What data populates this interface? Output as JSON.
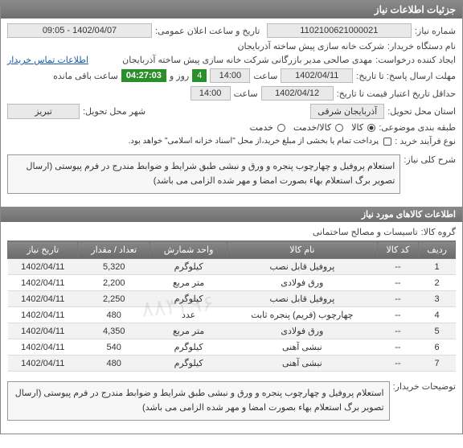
{
  "header": {
    "title": "جزئیات اطلاعات نیاز"
  },
  "info": {
    "req_no_label": "شماره نیاز:",
    "req_no": "1102100621000021",
    "datetime_label": "تاریخ و ساعت اعلان عمومی:",
    "datetime": "1402/04/07 - 09:05",
    "org_label": "نام دستگاه خریدار:",
    "org": "شرکت خانه سازی پیش ساخته آذربایجان",
    "creator_label": "ایجاد کننده درخواست:",
    "creator": "مهدی صالحی مدیر بازرگانی شرکت خانه سازی پیش ساخته آذربایجان",
    "contact_link": "اطلاعات تماس خریدار",
    "deadline_label": "مهلت ارسال پاسخ: تا تاریخ:",
    "deadline_date": "1402/04/11",
    "deadline_time_label": "ساعت",
    "deadline_time": "14:00",
    "remain_days": "4",
    "remain_days_label": "روز و",
    "countdown": "04:27:03",
    "remain_suffix": "ساعت باقی مانده",
    "valid_label": "حداقل تاریخ اعتبار قیمت تا تاریخ:",
    "valid_date": "1402/04/12",
    "valid_time": "14:00",
    "province_label": "استان محل تحویل:",
    "province": "آذربایجان شرقی",
    "city_label": "شهر محل تحویل:",
    "city": "تبریز",
    "cat_label": "طبقه بندی موضوعی:",
    "cat_goods": "کالا",
    "cat_service": "کالا/خدمت",
    "cat_svc": "خدمت",
    "process_label": "نوع فرآیند خرید :",
    "process_note": "پرداخت تمام یا بخشی از مبلغ خرید،از محل \"اسناد خزانه اسلامی\" خواهد بود.",
    "desc_label": "شرح کلی نیاز:",
    "desc": "استعلام پروفیل و چهارچوب پنجره و ورق و نبشی طبق شرایط و ضوابط مندرج در فرم پیوستی (ارسال تصویر برگ استعلام بهاء بصورت امضا و مهر شده الزامی می باشد)"
  },
  "items_header": "اطلاعات کالاهای مورد نیاز",
  "group_label": "گروه کالا:",
  "group": "تاسیسات و مصالح ساختمانی",
  "table": {
    "cols": [
      "ردیف",
      "کد کالا",
      "نام کالا",
      "واحد شمارش",
      "تعداد / مقدار",
      "تاریخ نیاز"
    ],
    "rows": [
      [
        "1",
        "--",
        "پروفیل قابل نصب",
        "کیلوگرم",
        "5,320",
        "1402/04/11"
      ],
      [
        "2",
        "--",
        "ورق فولادی",
        "متر مربع",
        "2,200",
        "1402/04/11"
      ],
      [
        "3",
        "--",
        "پروفیل قابل نصب",
        "کیلوگرم",
        "2,250",
        "1402/04/11"
      ],
      [
        "4",
        "--",
        "چهارچوب (فریم) پنجره ثابت",
        "عدد",
        "480",
        "1402/04/11"
      ],
      [
        "5",
        "--",
        "ورق فولادی",
        "متر مربع",
        "4,350",
        "1402/04/11"
      ],
      [
        "6",
        "--",
        "نبشی آهنی",
        "کیلوگرم",
        "540",
        "1402/04/11"
      ],
      [
        "7",
        "--",
        "نبشی آهنی",
        "کیلوگرم",
        "480",
        "1402/04/11"
      ]
    ]
  },
  "buyer_note_label": "توضیحات خریدار:",
  "buyer_note": "استعلام پروفیل و چهارچوب پنجره و ورق و نبشی طبق شرایط و ضوابط مندرج در فرم پیوستی (ارسال تصویر برگ استعلام بهاء بصورت امضا و مهر شده الزامی می باشد)"
}
